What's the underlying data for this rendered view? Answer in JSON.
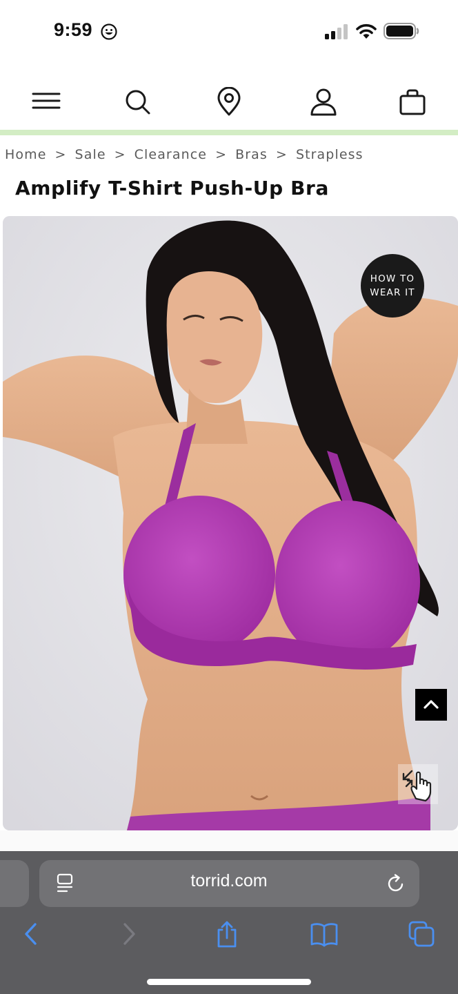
{
  "status_bar": {
    "time": "9:59",
    "emoji_icon": "smiley-icon",
    "signal_icon": "cellular-signal-icon",
    "wifi_icon": "wifi-icon",
    "battery_icon": "battery-icon"
  },
  "header": {
    "icons": [
      "menu-icon",
      "search-icon",
      "location-pin-icon",
      "account-icon",
      "shopping-bag-icon"
    ],
    "accent_color": "#d3edc4"
  },
  "breadcrumb": {
    "items": [
      "Home",
      "Sale",
      "Clearance",
      "Bras",
      "Strapless"
    ],
    "separator": ">"
  },
  "product": {
    "title": "Amplify T-Shirt Push-Up Bra",
    "how_to_wear_label": "HOW TO WEAR IT",
    "garment_color": "#b13ab1"
  },
  "browser": {
    "url": "torrid.com",
    "toolbar_icons": [
      "back-arrow-icon",
      "forward-arrow-icon",
      "share-icon",
      "bookmarks-icon",
      "tabs-icon"
    ],
    "accent": "#3b82f6"
  }
}
